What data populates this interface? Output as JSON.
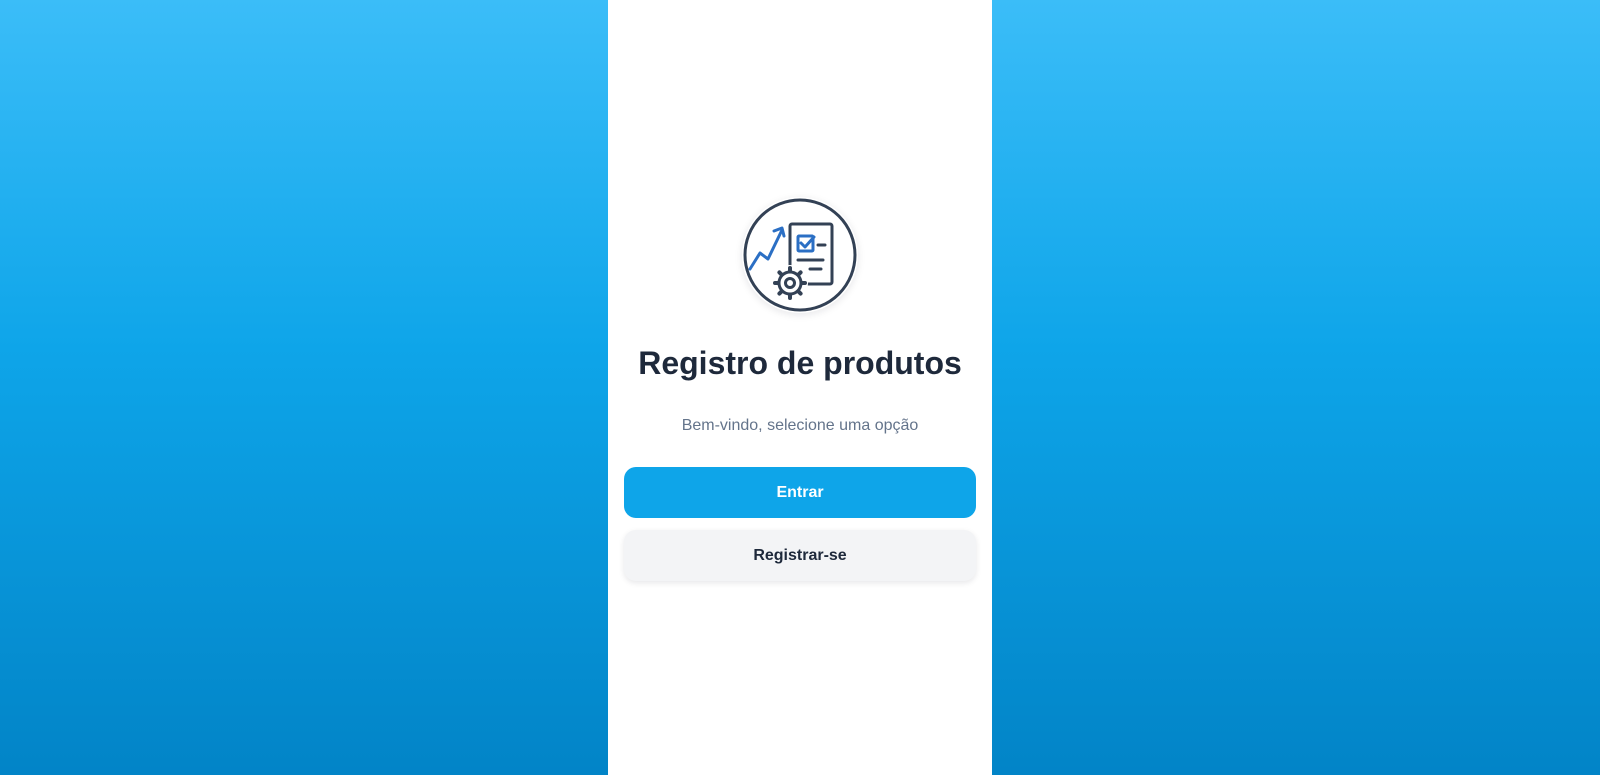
{
  "app": {
    "title": "Registro de produtos",
    "subtitle": "Bem-vindo, selecione uma opção",
    "logo_icon": "product-registry-icon"
  },
  "actions": {
    "login_label": "Entrar",
    "register_label": "Registrar-se"
  },
  "colors": {
    "background_top": "#3bbdf8",
    "background_bottom": "#0284c7",
    "primary": "#0ea5e9",
    "title_text": "#1e293b",
    "subtitle_text": "#64748b",
    "secondary_button": "#f3f4f6"
  }
}
